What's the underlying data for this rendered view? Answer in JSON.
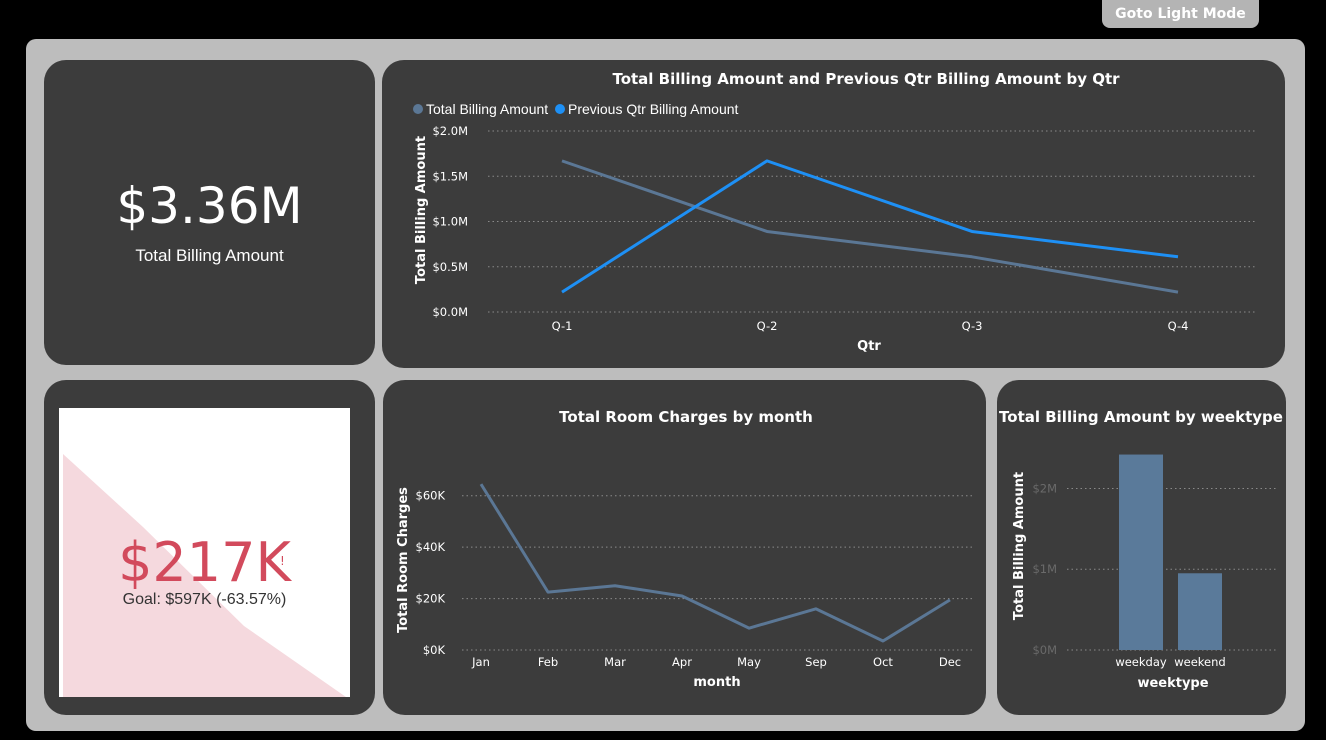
{
  "header": {
    "mode_button_label": "Goto Light Mode"
  },
  "kpi": {
    "value": "$3.36M",
    "label": "Total Billing Amount"
  },
  "gauge": {
    "value": "$217K",
    "indicator": "!",
    "goal_text": "Goal: $597K (-63.57%)",
    "progress": 0.3643
  },
  "colors": {
    "page_bg": "#000000",
    "frame": "#bdbdbd",
    "card": "#3c3c3c",
    "series_total": "#5b7795",
    "series_prev": "#1e90f5",
    "bar": "#5a7a9a",
    "gauge_value": "#d24a5c",
    "gauge_fill": "#f5d9de"
  },
  "chart_data": [
    {
      "type": "line",
      "title": "Total Billing Amount and Previous Qtr Billing Amount by Qtr",
      "xlabel": "Qtr",
      "ylabel": "Total Billing Amount",
      "categories": [
        "Q-1",
        "Q-2",
        "Q-3",
        "Q-4"
      ],
      "series": [
        {
          "name": "Total Billing Amount",
          "values": [
            1.67,
            0.89,
            0.61,
            0.22
          ]
        },
        {
          "name": "Previous Qtr Billing Amount",
          "values": [
            0.22,
            1.67,
            0.89,
            0.61
          ]
        }
      ],
      "ylim": [
        0,
        2.0
      ],
      "yticks": [
        "$0.0M",
        "$0.5M",
        "$1.0M",
        "$1.5M",
        "$2.0M"
      ],
      "legend": "top-left",
      "grid": true
    },
    {
      "type": "line",
      "title": "Total Room Charges by month",
      "xlabel": "month",
      "ylabel": "Total Room Charges",
      "categories": [
        "Jan",
        "Feb",
        "Mar",
        "Apr",
        "May",
        "Sep",
        "Oct",
        "Dec"
      ],
      "series": [
        {
          "values": [
            64.5,
            22.5,
            25,
            21,
            8.5,
            16,
            3.5,
            19.5
          ]
        }
      ],
      "ylim": [
        0,
        70
      ],
      "yticks": [
        "$0K",
        "$20K",
        "$40K",
        "$60K"
      ],
      "grid": true
    },
    {
      "type": "bar",
      "title": "Total Billing Amount by weektype",
      "xlabel": "weektype",
      "ylabel": "Total Billing Amount",
      "categories": [
        "weekday",
        "weekend"
      ],
      "values": [
        2.42,
        0.95
      ],
      "ylim": [
        0,
        2.6
      ],
      "yticks": [
        "$0M",
        "$1M",
        "$2M"
      ],
      "grid": true
    }
  ]
}
